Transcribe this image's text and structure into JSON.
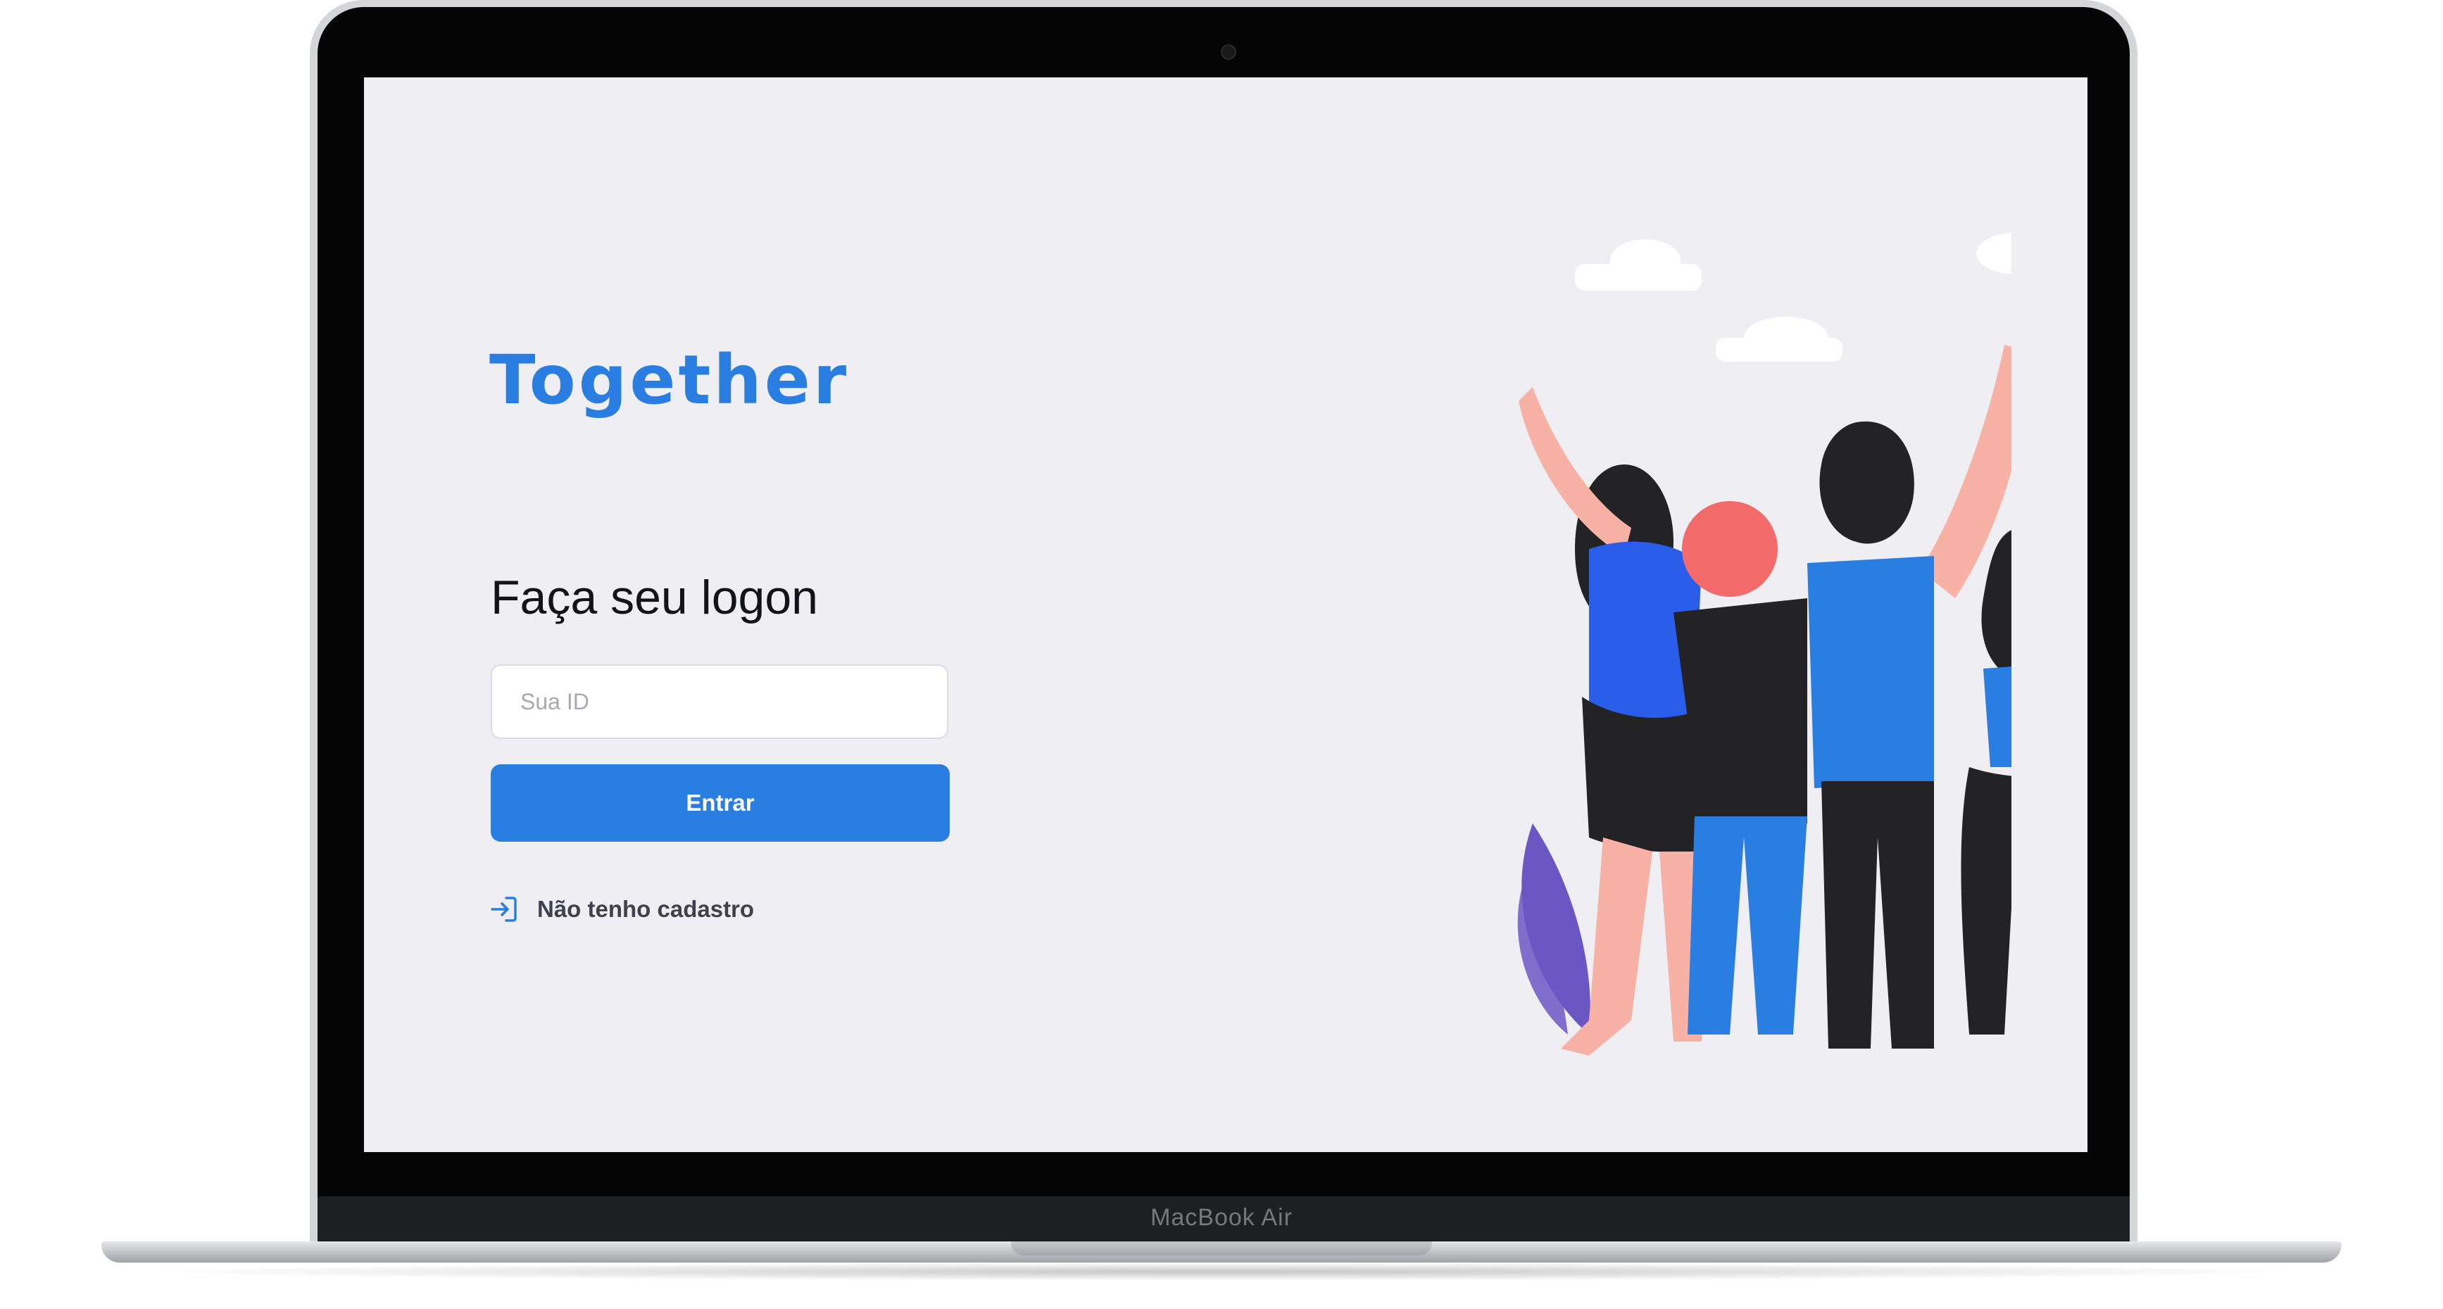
{
  "device": {
    "model_label": "MacBook Air"
  },
  "brand": {
    "name": "Together",
    "color": "#2a7de1"
  },
  "logon": {
    "title": "Faça seu logon",
    "id_placeholder": "Sua ID",
    "id_value": "",
    "submit_label": "Entrar",
    "register_link_label": "Não tenho cadastro",
    "register_icon": "log-in-icon"
  },
  "illustration": {
    "subject": "group-of-friends-hugging-icon"
  },
  "colors": {
    "accent": "#2a7de1",
    "background": "#efeff3",
    "text": "#13131a",
    "link_text": "#41414d"
  }
}
